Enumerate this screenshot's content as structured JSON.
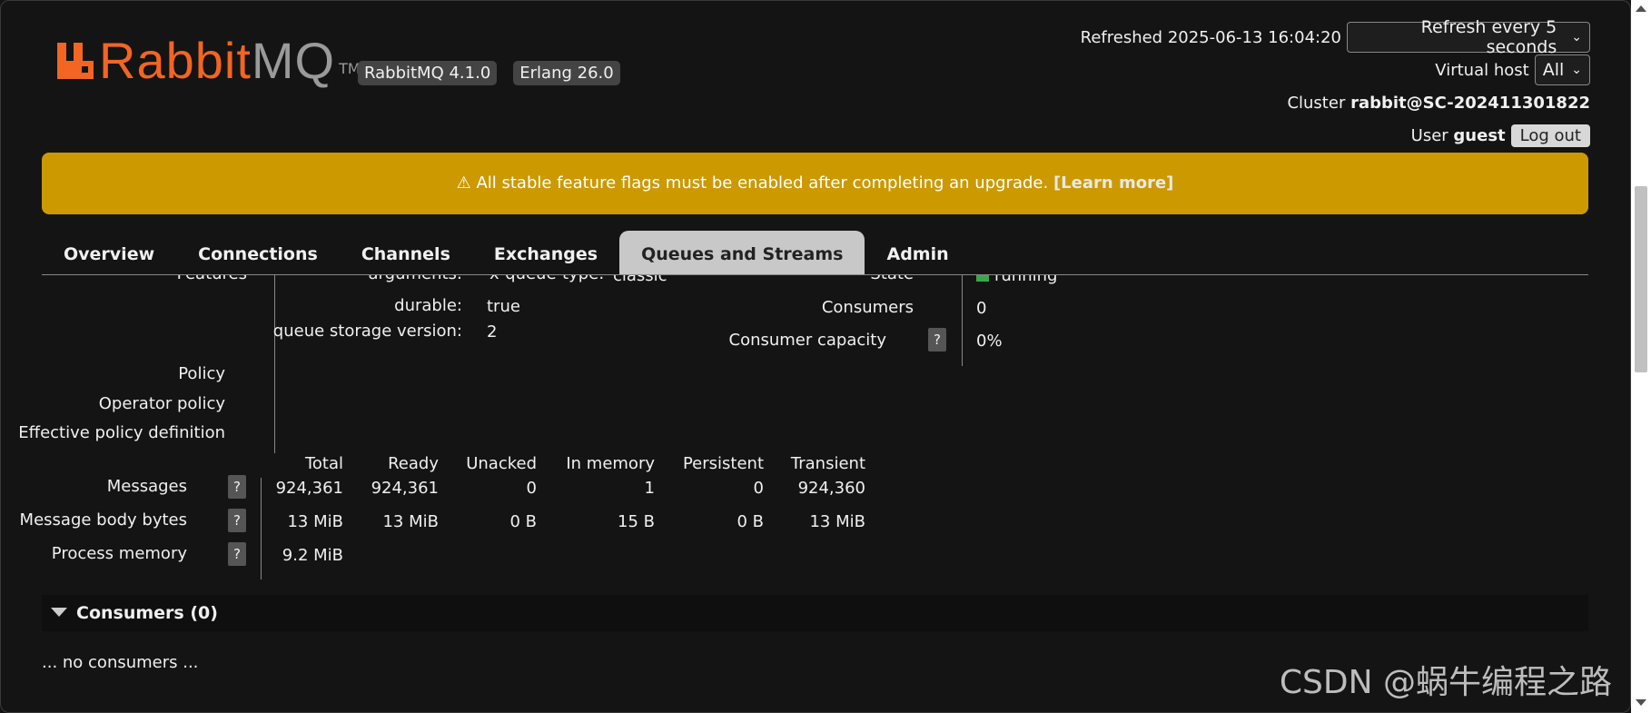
{
  "brand": {
    "name_left": "Rabbit",
    "name_right": "MQ",
    "tm": "TM"
  },
  "versions": {
    "rabbitmq": "RabbitMQ 4.1.0",
    "erlang": "Erlang 26.0"
  },
  "header": {
    "refreshed": "Refreshed 2025-06-13 16:04:20",
    "refresh_option": "Refresh every 5 seconds",
    "vhost_label": "Virtual host",
    "vhost_value": "All",
    "cluster_label": "Cluster",
    "cluster_value": "rabbit@SC-202411301822",
    "user_label": "User",
    "user_value": "guest",
    "logout": "Log out"
  },
  "banner": {
    "text": "⚠ All stable feature flags must be enabled after completing an upgrade.",
    "link": "[Learn more]"
  },
  "tabs": [
    "Overview",
    "Connections",
    "Channels",
    "Exchanges",
    "Queues and Streams",
    "Admin"
  ],
  "details": {
    "features_label": "Features",
    "arguments_label": "arguments:",
    "arguments_value": "x-queue-type:",
    "arguments_type": "classic",
    "durable_label": "durable:",
    "durable_value": "true",
    "storage_label": "queue storage version:",
    "storage_value": "2",
    "policy_label": "Policy",
    "operator_policy_label": "Operator policy",
    "effective_policy_label": "Effective policy definition",
    "state_label": "State",
    "state_value": "running",
    "consumers_label": "Consumers",
    "consumers_value": "0",
    "capacity_label": "Consumer capacity",
    "capacity_value": "0%",
    "help": "?"
  },
  "stats": {
    "columns": [
      "Total",
      "Ready",
      "Unacked",
      "In memory",
      "Persistent",
      "Transient"
    ],
    "rows": [
      {
        "label": "Messages",
        "values": [
          "924,361",
          "924,361",
          "0",
          "1",
          "0",
          "924,360"
        ]
      },
      {
        "label": "Message body bytes",
        "values": [
          "13 MiB",
          "13 MiB",
          "0 B",
          "15 B",
          "0 B",
          "13 MiB"
        ]
      },
      {
        "label": "Process memory",
        "values": [
          "9.2 MiB"
        ]
      }
    ]
  },
  "consumers_section": {
    "title": "Consumers (0)",
    "empty": "... no consumers ..."
  },
  "watermark": "CSDN @蜗牛编程之路"
}
